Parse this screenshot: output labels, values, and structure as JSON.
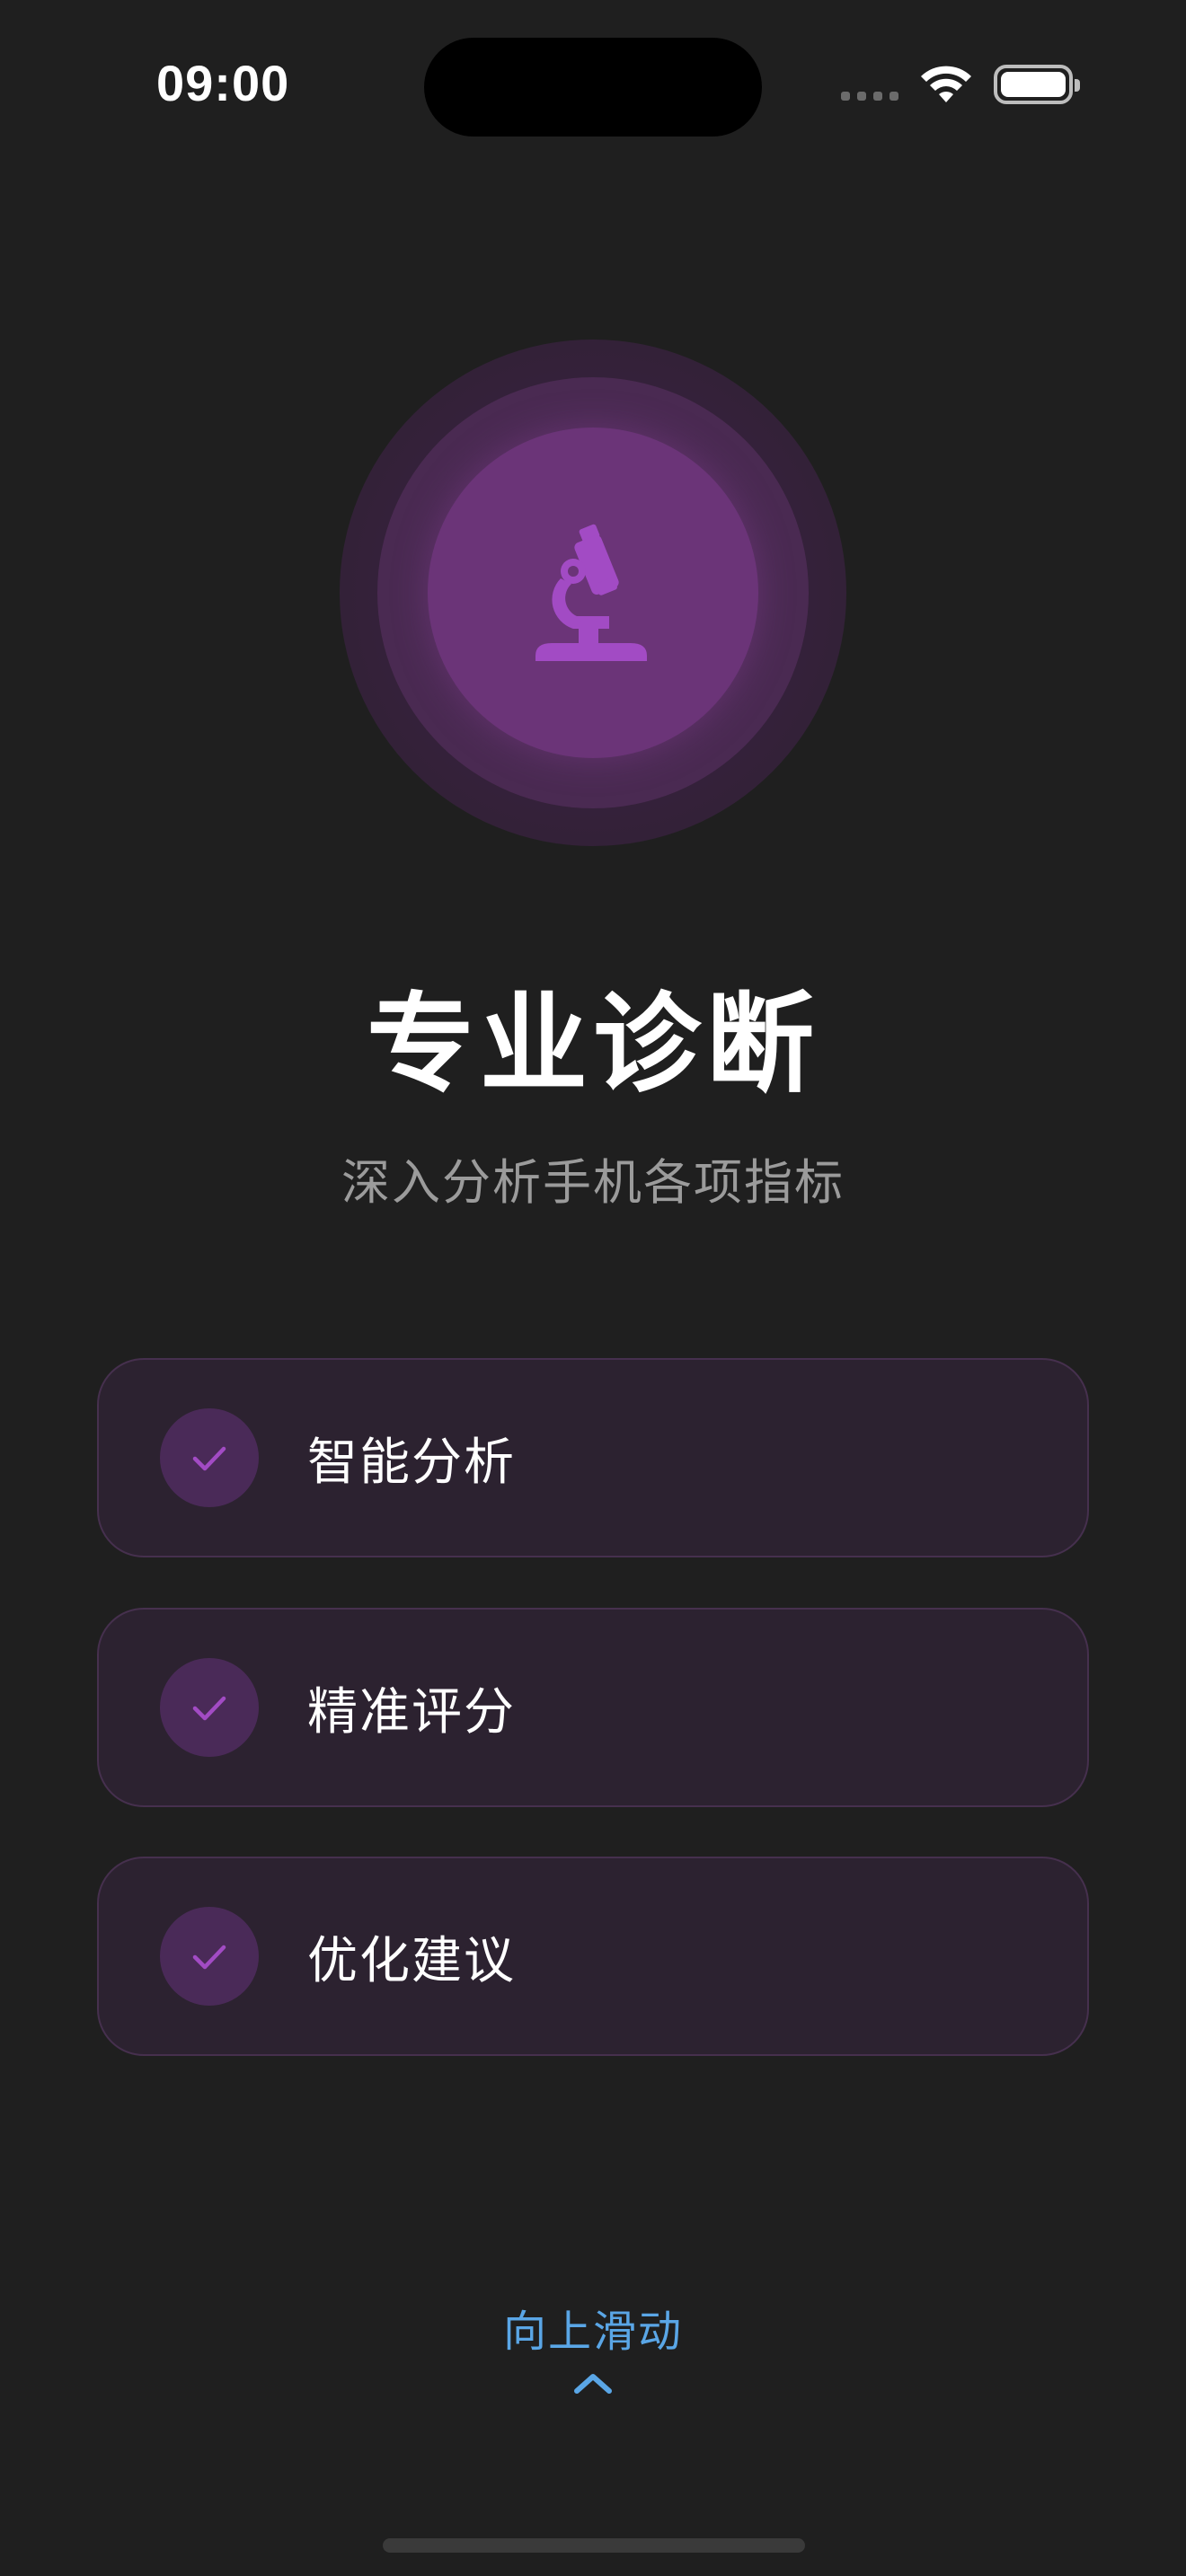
{
  "status_bar": {
    "time": "09:00"
  },
  "hero": {
    "icon": "microscope-icon",
    "title": "专业诊断",
    "subtitle": "深入分析手机各项指标"
  },
  "features": [
    {
      "label": "智能分析",
      "icon": "check-icon"
    },
    {
      "label": "精准评分",
      "icon": "check-icon"
    },
    {
      "label": "优化建议",
      "icon": "check-icon"
    }
  ],
  "swipe_hint": {
    "label": "向上滑动",
    "icon": "chevron-up-icon"
  },
  "colors": {
    "background": "#1f1f1f",
    "accent_purple": "#9a45b8",
    "card_background": "#2c2230",
    "hint_blue": "#5aa6e6"
  }
}
